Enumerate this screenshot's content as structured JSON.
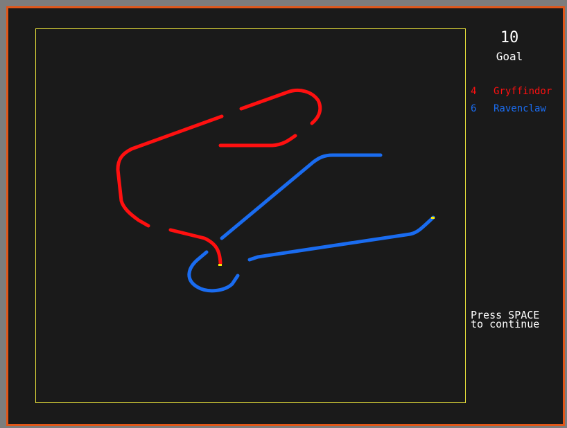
{
  "goal": {
    "value": "10",
    "label": "Goal"
  },
  "scores": [
    {
      "points": "4",
      "team": "Gryffindor",
      "color": "#ff1010"
    },
    {
      "points": "6",
      "team": "Ravenclaw",
      "color": "#1a6cf0"
    }
  ],
  "prompt": {
    "line1": "Press SPACE",
    "line2": "to continue"
  },
  "colors": {
    "field_border": "#e9e23a",
    "window_border": "#e0571a",
    "background": "#1a1a1a",
    "player_head": "#f5e60a"
  }
}
